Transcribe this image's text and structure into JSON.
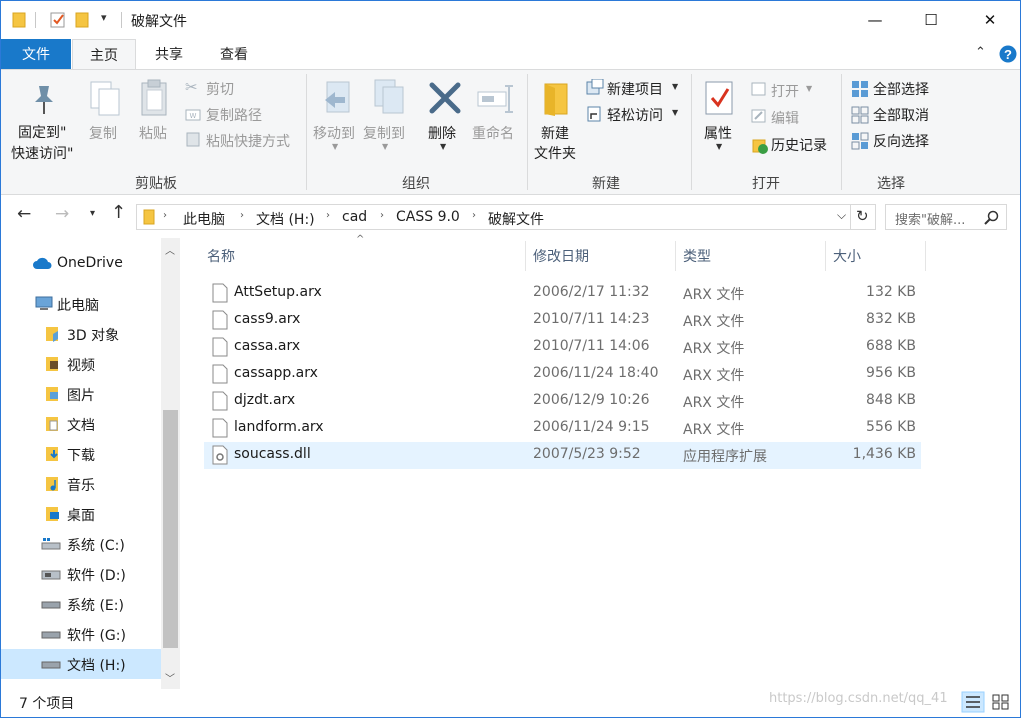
{
  "window": {
    "title": "破解文件",
    "controls": {
      "minimize": "—",
      "maximize": "☐",
      "close": "✕"
    }
  },
  "tabs": [
    {
      "label": "文件"
    },
    {
      "label": "主页"
    },
    {
      "label": "共享"
    },
    {
      "label": "查看"
    }
  ],
  "ribbon": {
    "clipboard": {
      "label": "剪贴板",
      "pin_line1": "固定到\"",
      "pin_line2": "快速访问\"",
      "copy": "复制",
      "paste": "粘贴",
      "cut": "剪切",
      "copy_path": "复制路径",
      "paste_shortcut": "粘贴快捷方式"
    },
    "organize": {
      "label": "组织",
      "move_to": "移动到",
      "copy_to": "复制到",
      "delete": "删除",
      "rename": "重命名"
    },
    "new": {
      "label": "新建",
      "new_folder_line1": "新建",
      "new_folder_line2": "文件夹",
      "new_item": "新建项目",
      "easy_access": "轻松访问"
    },
    "open": {
      "label": "打开",
      "properties": "属性",
      "open": "打开",
      "edit": "编辑",
      "history": "历史记录"
    },
    "select": {
      "label": "选择",
      "select_all": "全部选择",
      "select_none": "全部取消",
      "invert": "反向选择"
    }
  },
  "address": {
    "crumbs": [
      "此电脑",
      "文档 (H:)",
      "cad",
      "CASS 9.0",
      "破解文件"
    ],
    "search_placeholder": "搜索\"破解..."
  },
  "nav": [
    {
      "label": "OneDrive"
    },
    {
      "label": "此电脑"
    },
    {
      "label": "3D 对象"
    },
    {
      "label": "视频"
    },
    {
      "label": "图片"
    },
    {
      "label": "文档"
    },
    {
      "label": "下载"
    },
    {
      "label": "音乐"
    },
    {
      "label": "桌面"
    },
    {
      "label": "系统 (C:)"
    },
    {
      "label": "软件 (D:)"
    },
    {
      "label": "系统 (E:)"
    },
    {
      "label": "软件 (G:)"
    },
    {
      "label": "文档 (H:)"
    }
  ],
  "columns": {
    "name": "名称",
    "date": "修改日期",
    "type": "类型",
    "size": "大小"
  },
  "files": [
    {
      "name": "AttSetup.arx",
      "date": "2006/2/17 11:32",
      "type": "ARX 文件",
      "size": "132 KB"
    },
    {
      "name": "cass9.arx",
      "date": "2010/7/11 14:23",
      "type": "ARX 文件",
      "size": "832 KB"
    },
    {
      "name": "cassa.arx",
      "date": "2010/7/11 14:06",
      "type": "ARX 文件",
      "size": "688 KB"
    },
    {
      "name": "cassapp.arx",
      "date": "2006/11/24 18:40",
      "type": "ARX 文件",
      "size": "956 KB"
    },
    {
      "name": "djzdt.arx",
      "date": "2006/12/9 10:26",
      "type": "ARX 文件",
      "size": "848 KB"
    },
    {
      "name": "landform.arx",
      "date": "2006/11/24 9:15",
      "type": "ARX 文件",
      "size": "556 KB"
    },
    {
      "name": "soucass.dll",
      "date": "2007/5/23 9:52",
      "type": "应用程序扩展",
      "size": "1,436 KB"
    }
  ],
  "status": {
    "count": "7 个项目"
  },
  "watermark": "https://blog.csdn.net/qq_41"
}
